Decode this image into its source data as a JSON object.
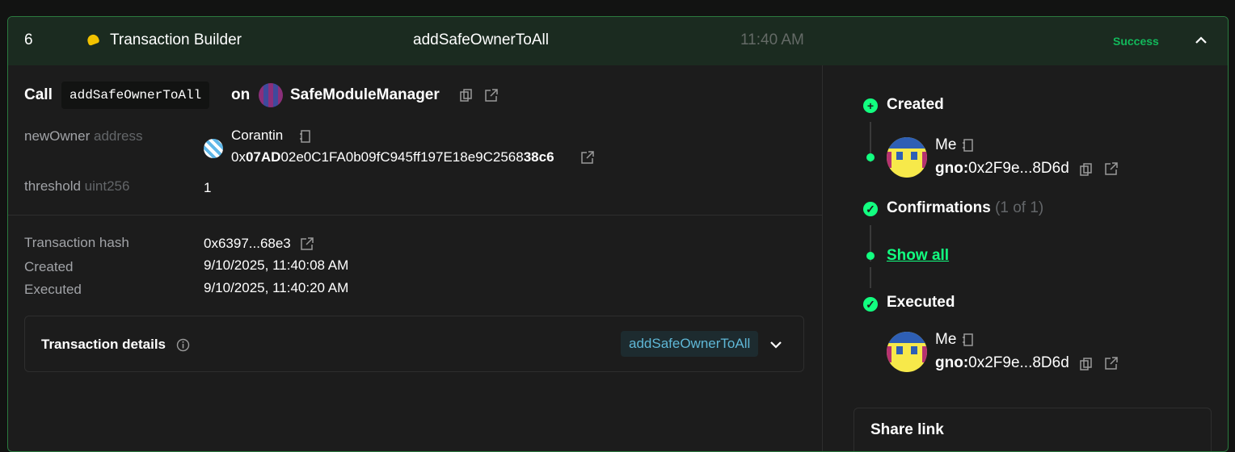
{
  "header": {
    "nonce": "6",
    "app_name": "Transaction Builder",
    "method": "addSafeOwnerToAll",
    "time": "11:40 AM",
    "status": "Success"
  },
  "call": {
    "prefix": "Call",
    "method": "addSafeOwnerToAll",
    "on": "on",
    "contract": "SafeModuleManager"
  },
  "params": [
    {
      "name": "newOwner",
      "type": "address",
      "owner_name": "Corantin",
      "address_prefix": "0x",
      "address_bold_start": "07AD",
      "address_middle": "02e0C1FA0b09fC945ff197E18e9C2568",
      "address_bold_end": "38c6"
    },
    {
      "name": "threshold",
      "type": "uint256",
      "value": "1"
    }
  ],
  "info": {
    "tx_hash_label": "Transaction hash",
    "tx_hash": "0x6397...68e3",
    "created_label": "Created",
    "created": "9/10/2025, 11:40:08 AM",
    "executed_label": "Executed",
    "executed": "9/10/2025, 11:40:20 AM"
  },
  "details": {
    "label": "Transaction details",
    "method_chip": "addSafeOwnerToAll"
  },
  "timeline": {
    "created_label": "Created",
    "created_by": "Me",
    "created_chain": "gno:",
    "created_addr": "0x2F9e...8D6d",
    "confirmations_label": "Confirmations",
    "confirmations_count": "(1 of 1)",
    "show_all": "Show all",
    "executed_label": "Executed",
    "executed_by": "Me",
    "executed_chain": "gno:",
    "executed_addr": "0x2F9e...8D6d"
  },
  "share": {
    "label": "Share link"
  }
}
